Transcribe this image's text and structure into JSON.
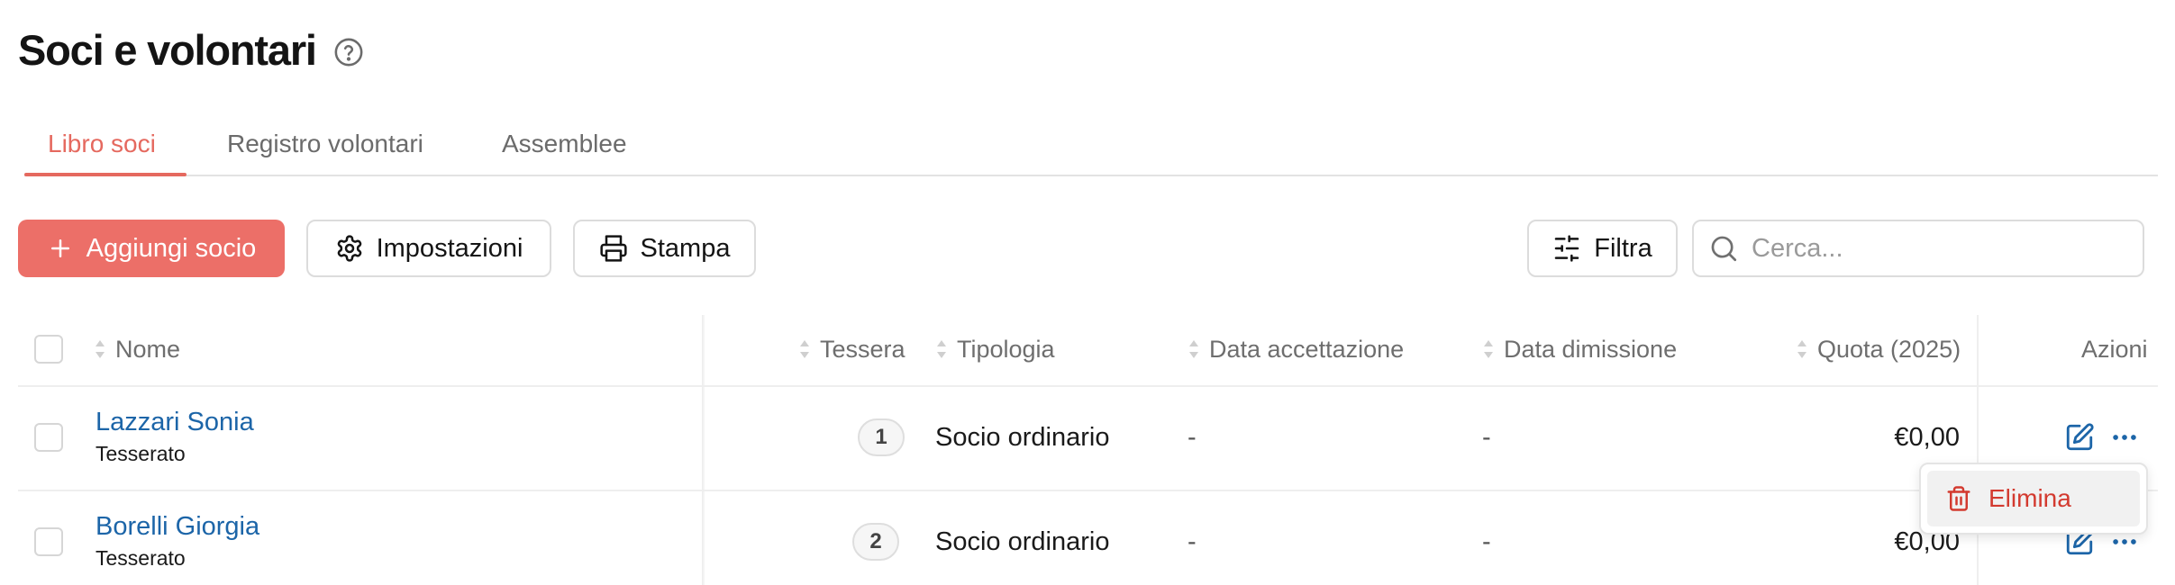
{
  "header": {
    "title": "Soci e volontari"
  },
  "tabs": [
    {
      "label": "Libro soci",
      "active": true
    },
    {
      "label": "Registro volontari",
      "active": false
    },
    {
      "label": "Assemblee",
      "active": false
    }
  ],
  "toolbar": {
    "add_label": "Aggiungi socio",
    "settings_label": "Impostazioni",
    "print_label": "Stampa",
    "filter_label": "Filtra",
    "search_placeholder": "Cerca..."
  },
  "table": {
    "columns": {
      "nome": "Nome",
      "tessera": "Tessera",
      "tipologia": "Tipologia",
      "data_accettazione": "Data accettazione",
      "data_dimissione": "Data dimissione",
      "quota": "Quota (2025)",
      "azioni": "Azioni"
    },
    "rows": [
      {
        "name": "Lazzari Sonia",
        "status": "Tesserato",
        "tessera": "1",
        "tipologia": "Socio ordinario",
        "data_accettazione": "-",
        "data_dimissione": "-",
        "quota": "€0,00"
      },
      {
        "name": "Borelli Giorgia",
        "status": "Tesserato",
        "tessera": "2",
        "tipologia": "Socio ordinario",
        "data_accettazione": "-",
        "data_dimissione": "-",
        "quota": "€0,00"
      }
    ]
  },
  "row_menu": {
    "delete_label": "Elimina"
  },
  "colors": {
    "accent": "#ec6f68",
    "link": "#1c65a8",
    "danger": "#d33a2f"
  }
}
